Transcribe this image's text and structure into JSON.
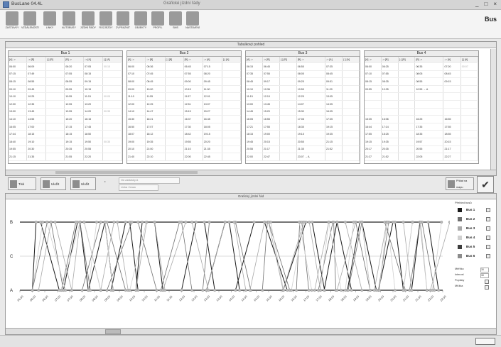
{
  "window": {
    "app_title": "BusLane 04.4L",
    "doc_title": "Grafické jízdní řády",
    "controls": [
      "_",
      "□",
      "×"
    ]
  },
  "toolbar": [
    {
      "label": "ZASTÁVKY",
      "icon": "stops-icon"
    },
    {
      "label": "VZDÁLENOSTI",
      "icon": "distance-icon"
    },
    {
      "label": "LINKY",
      "icon": "lines-icon"
    },
    {
      "label": "AUTOBUSY",
      "icon": "bus-icon"
    },
    {
      "label": "JÍZDNÍ ŘÁDY",
      "icon": "timetable-icon"
    },
    {
      "label": "ROZJEZDY",
      "icon": "departures-icon"
    },
    {
      "label": "ZVÝRAZNIT",
      "icon": "highlight-icon"
    },
    {
      "label": "OBJEKTY",
      "icon": "objects-icon"
    },
    {
      "label": "PROFIL",
      "icon": "profile-icon"
    },
    {
      "label": "SMS",
      "icon": "sms-icon"
    },
    {
      "label": "NASTAVENÍ",
      "icon": "settings-icon"
    }
  ],
  "logo": "Bus",
  "top_panel": {
    "title": "Tabulkový pohled",
    "buses": [
      {
        "name": "Bus 1",
        "columns": [
          "[A] ->",
          "-> [B]",
          "[-] [B]",
          "[B] ->",
          "-> [A]",
          "[-] [A]"
        ],
        "rows": [
          [
            "06:00",
            "06:09",
            "",
            "06:20",
            "07:05",
            "00:15"
          ],
          [
            "07:15",
            "07:49",
            "",
            "07:55",
            "08:15",
            ""
          ],
          [
            "08:15",
            "08:55",
            "",
            "08:55",
            "09:15",
            ""
          ],
          [
            "09:10",
            "09:45",
            "",
            "09:55",
            "10:15",
            ""
          ],
          [
            "10:10",
            "10:25",
            "",
            "10:55",
            "11:15",
            "00:05"
          ],
          [
            "12:00",
            "12:35",
            "",
            "12:55",
            "13:20",
            ""
          ],
          [
            "13:00",
            "13:45",
            "",
            "13:55",
            "14:20",
            "00:35"
          ],
          [
            "14:10",
            "14:55",
            "",
            "15:20",
            "16:15",
            ""
          ],
          [
            "16:05",
            "17:00",
            "",
            "17:15",
            "17:45",
            ""
          ],
          [
            "17:44",
            "18:15",
            "",
            "18:15",
            "18:50",
            ""
          ],
          [
            "18:40",
            "19:10",
            "",
            "19:15",
            "19:50",
            "00:35"
          ],
          [
            "19:55",
            "20:30",
            "",
            "20:35",
            "20:55",
            ""
          ],
          [
            "21:15",
            "21:35",
            "",
            "21:55",
            "22:20",
            ""
          ]
        ]
      },
      {
        "name": "Bus 2",
        "columns": [
          "[A] ->",
          "-> [B]",
          "[-] [B]",
          "[B] ->",
          "-> [A]",
          "[-] [A]"
        ],
        "rows": [
          [
            "06:00",
            "06:36",
            "",
            "06:45",
            "07:15",
            ""
          ],
          [
            "07:10",
            "07:45",
            "",
            "07:55",
            "08:20",
            ""
          ],
          [
            "08:00",
            "08:45",
            "",
            "09:00",
            "09:45",
            ""
          ],
          [
            "09:00",
            "10:00",
            "",
            "10:15",
            "11:00",
            ""
          ],
          [
            "11:10",
            "11:55",
            "",
            "11:57",
            "12:01",
            ""
          ],
          [
            "12:00",
            "12:25",
            "",
            "12:51",
            "13:07",
            ""
          ],
          [
            "14:10",
            "14:47",
            "",
            "15:15",
            "15:27",
            ""
          ],
          [
            "15:30",
            "16:21",
            "",
            "16:37",
            "16:45",
            ""
          ],
          [
            "16:50",
            "17:07",
            "",
            "17:30",
            "18:05",
            ""
          ],
          [
            "18:07",
            "18:12",
            "",
            "18:42",
            "19:15",
            ""
          ],
          [
            "19:00",
            "19:35",
            "",
            "19:55",
            "20:20",
            ""
          ],
          [
            "20:10",
            "21:00",
            "",
            "21:10",
            "21:35",
            ""
          ],
          [
            "21:40",
            "22:10",
            "",
            "22:00",
            "22:45",
            ""
          ]
        ]
      },
      {
        "name": "Bus 3",
        "columns": [
          "[A] ->",
          "-> [B]",
          "[-] [B]",
          "[B] ->",
          "-> [A]",
          "[-] [A]"
        ],
        "rows": [
          [
            "06:15",
            "06:45",
            "",
            "06:55",
            "07:35",
            ""
          ],
          [
            "07:35",
            "07:55",
            "",
            "08:05",
            "08:45",
            ""
          ],
          [
            "08:45",
            "09:17",
            "",
            "09:25",
            "09:51",
            ""
          ],
          [
            "10:10",
            "10:36",
            "",
            "10:55",
            "11:20",
            ""
          ],
          [
            "11:15",
            "12:10",
            "",
            "12:25",
            "13:05",
            ""
          ],
          [
            "13:00",
            "13:45",
            "",
            "14:07",
            "14:35",
            ""
          ],
          [
            "14:45",
            "15:20",
            "",
            "15:30",
            "16:05",
            ""
          ],
          [
            "16:05",
            "16:55",
            "",
            "17:08",
            "17:35",
            ""
          ],
          [
            "17:21",
            "17:55",
            "",
            "18:35",
            "19:15",
            ""
          ],
          [
            "18:15",
            "19:00",
            "",
            "19:15",
            "19:35",
            ""
          ],
          [
            "19:45",
            "20:15",
            "",
            "20:55",
            "21:15",
            ""
          ],
          [
            "20:55",
            "21:17",
            "",
            "21:35",
            "21:52",
            ""
          ],
          [
            "22:00",
            "22:47",
            "",
            "23:07 → A",
            "",
            ""
          ]
        ]
      },
      {
        "name": "Bus 4",
        "columns": [
          "[A] ->",
          "-> [B]",
          "[-] [B]",
          "[B] ->",
          "-> [A]",
          "[-] [A]"
        ],
        "rows": [
          [
            "06:00",
            "06:25",
            "",
            "06:35",
            "07:20",
            "00:07"
          ],
          [
            "07:10",
            "07:55",
            "",
            "08:05",
            "08:45",
            ""
          ],
          [
            "08:15",
            "08:35",
            "",
            "08:55",
            "09:15",
            ""
          ],
          [
            "09:55",
            "10:35",
            "",
            "10:55 → A",
            "",
            ""
          ],
          [
            "",
            "",
            "",
            "",
            "",
            ""
          ],
          [
            "",
            "",
            "",
            "",
            "",
            ""
          ],
          [
            "",
            "",
            "",
            "",
            "",
            ""
          ],
          [
            "15:35",
            "16:06",
            "",
            "16:25",
            "16:55",
            ""
          ],
          [
            "16:44",
            "17:14",
            "",
            "17:35",
            "17:55",
            ""
          ],
          [
            "17:55",
            "18:25",
            "",
            "18:35",
            "18:55",
            ""
          ],
          [
            "19:15",
            "19:35",
            "",
            "19:57",
            "20:15",
            ""
          ],
          [
            "20:17",
            "20:35",
            "",
            "20:55",
            "21:17",
            ""
          ],
          [
            "21:37",
            "21:52",
            "",
            "22:05",
            "22:27",
            ""
          ]
        ]
      }
    ]
  },
  "controls": {
    "buttons": [
      {
        "label": "Tisk rozpisu",
        "icon": "print-icon"
      },
      {
        "label": "Uložit",
        "icon": "save-icon"
      },
      {
        "label": "Uložit jako",
        "icon": "save-as-icon"
      }
    ],
    "field1": "Od zastávky A",
    "field2": "Linka / trasa",
    "right_button": "Přidat na mapu",
    "ok_label": "✔"
  },
  "chart_panel": {
    "title": "Grafický jízdní řád",
    "legend_title": "Přehled busů",
    "legend": [
      {
        "name": "Bus 1",
        "color": "#1a1a1a"
      },
      {
        "name": "Bus 2",
        "color": "#6e6e6e"
      },
      {
        "name": "Bus 3",
        "color": "#a8a8a8"
      },
      {
        "name": "Bus 4",
        "color": "#cfcfcf"
      },
      {
        "name": "Bus 5",
        "color": "#3d3d3d"
      },
      {
        "name": "Bus 6",
        "color": "#8c8c8c"
      }
    ],
    "options": [
      {
        "label": "Měřítko",
        "value": "30"
      },
      {
        "label": "Interval",
        "value": "30"
      },
      {
        "label": "Popisky",
        "value": ""
      },
      {
        "label": "Mřížka",
        "value": ""
      }
    ]
  },
  "chart_data": {
    "type": "line",
    "y_stops": [
      "B",
      "C",
      "A"
    ],
    "x_ticks": [
      "05:30",
      "06:00",
      "06:30",
      "07:00",
      "07:30",
      "08:00",
      "08:30",
      "09:00",
      "09:30",
      "10:00",
      "10:30",
      "11:00",
      "11:30",
      "12:00",
      "12:30",
      "13:00",
      "13:30",
      "14:00",
      "14:30",
      "15:00",
      "15:30",
      "16:00",
      "16:30",
      "17:00",
      "17:30",
      "18:00",
      "18:30",
      "19:00",
      "19:30",
      "20:00",
      "20:30",
      "21:00",
      "21:30",
      "22:00",
      "22:30"
    ],
    "x_range": [
      "05:30",
      "22:30"
    ],
    "series": [
      {
        "name": "Bus 1",
        "trips": [
          [
            "06:00",
            "06:09"
          ],
          [
            "06:20",
            "07:05"
          ],
          [
            "07:15",
            "07:49"
          ],
          [
            "07:55",
            "08:15"
          ],
          [
            "08:15",
            "08:55"
          ],
          [
            "08:55",
            "09:15"
          ],
          [
            "09:10",
            "09:45"
          ],
          [
            "09:55",
            "10:15"
          ],
          [
            "10:10",
            "10:25"
          ],
          [
            "10:55",
            "11:15"
          ],
          [
            "12:00",
            "12:35"
          ],
          [
            "12:55",
            "13:20"
          ],
          [
            "13:00",
            "13:45"
          ],
          [
            "13:55",
            "14:20"
          ],
          [
            "14:10",
            "14:55"
          ],
          [
            "15:20",
            "16:15"
          ],
          [
            "16:05",
            "17:00"
          ],
          [
            "17:15",
            "17:45"
          ],
          [
            "17:44",
            "18:15"
          ],
          [
            "18:15",
            "18:50"
          ],
          [
            "18:40",
            "19:10"
          ],
          [
            "19:15",
            "19:50"
          ],
          [
            "19:55",
            "20:30"
          ],
          [
            "20:35",
            "20:55"
          ],
          [
            "21:15",
            "21:35"
          ],
          [
            "21:55",
            "22:20"
          ]
        ]
      },
      {
        "name": "Bus 2",
        "trips": [
          [
            "06:00",
            "06:36"
          ],
          [
            "06:45",
            "07:15"
          ],
          [
            "07:10",
            "07:45"
          ],
          [
            "07:55",
            "08:20"
          ],
          [
            "08:00",
            "08:45"
          ],
          [
            "09:00",
            "09:45"
          ],
          [
            "09:00",
            "10:00"
          ],
          [
            "10:15",
            "11:00"
          ],
          [
            "11:10",
            "11:55"
          ],
          [
            "12:00",
            "12:25"
          ],
          [
            "12:51",
            "13:07"
          ],
          [
            "14:10",
            "14:47"
          ],
          [
            "15:15",
            "15:27"
          ],
          [
            "15:30",
            "16:21"
          ],
          [
            "16:37",
            "16:45"
          ],
          [
            "16:50",
            "17:07"
          ],
          [
            "17:30",
            "18:05"
          ],
          [
            "18:07",
            "18:12"
          ],
          [
            "18:42",
            "19:15"
          ],
          [
            "19:00",
            "19:35"
          ],
          [
            "19:55",
            "20:20"
          ],
          [
            "20:10",
            "21:00"
          ],
          [
            "21:10",
            "21:35"
          ],
          [
            "21:40",
            "22:10"
          ]
        ]
      },
      {
        "name": "Bus 3",
        "trips": [
          [
            "06:15",
            "06:45"
          ],
          [
            "06:55",
            "07:35"
          ],
          [
            "07:35",
            "07:55"
          ],
          [
            "08:05",
            "08:45"
          ],
          [
            "08:45",
            "09:17"
          ],
          [
            "09:25",
            "09:51"
          ],
          [
            "10:10",
            "10:36"
          ],
          [
            "10:55",
            "11:20"
          ],
          [
            "11:15",
            "12:10"
          ],
          [
            "12:25",
            "13:05"
          ],
          [
            "13:00",
            "13:45"
          ],
          [
            "14:07",
            "14:35"
          ],
          [
            "14:45",
            "15:20"
          ],
          [
            "15:30",
            "16:05"
          ],
          [
            "16:05",
            "16:55"
          ],
          [
            "17:08",
            "17:35"
          ],
          [
            "17:21",
            "17:55"
          ],
          [
            "18:35",
            "19:15"
          ],
          [
            "18:15",
            "19:00"
          ],
          [
            "19:15",
            "19:35"
          ],
          [
            "19:45",
            "20:15"
          ],
          [
            "20:55",
            "21:15"
          ],
          [
            "20:55",
            "21:17"
          ],
          [
            "21:35",
            "21:52"
          ],
          [
            "22:00",
            "22:47"
          ]
        ]
      },
      {
        "name": "Bus 4",
        "trips": [
          [
            "06:00",
            "06:25"
          ],
          [
            "06:35",
            "07:20"
          ],
          [
            "07:10",
            "07:55"
          ],
          [
            "08:05",
            "08:45"
          ],
          [
            "08:15",
            "08:35"
          ],
          [
            "08:55",
            "09:15"
          ],
          [
            "09:55",
            "10:35"
          ],
          [
            "15:35",
            "16:06"
          ],
          [
            "16:25",
            "16:55"
          ],
          [
            "16:44",
            "17:14"
          ],
          [
            "17:35",
            "17:55"
          ],
          [
            "17:55",
            "18:25"
          ],
          [
            "18:35",
            "18:55"
          ],
          [
            "19:15",
            "19:35"
          ],
          [
            "19:57",
            "20:15"
          ],
          [
            "20:17",
            "20:35"
          ],
          [
            "20:55",
            "21:17"
          ],
          [
            "21:37",
            "21:52"
          ],
          [
            "22:05",
            "22:27"
          ]
        ]
      }
    ]
  }
}
